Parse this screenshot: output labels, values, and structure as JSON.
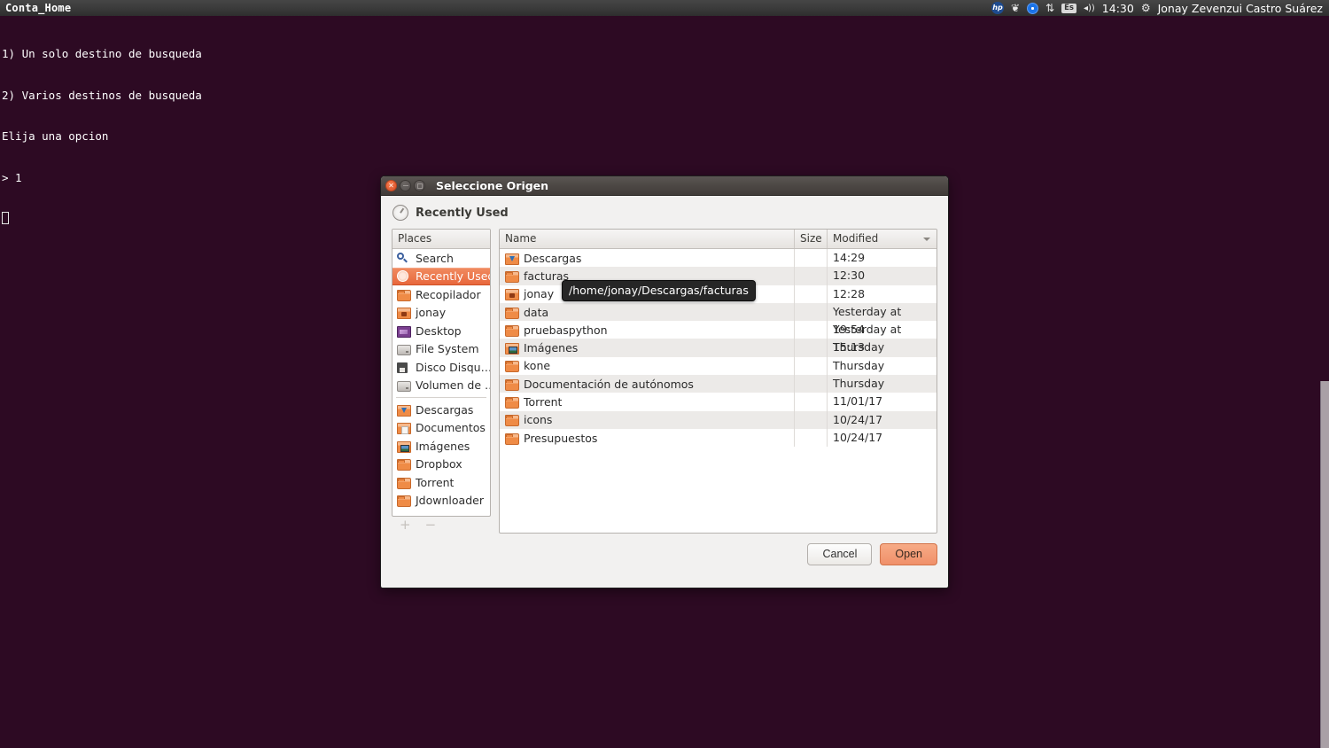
{
  "panel": {
    "app_title": "Conta_Home",
    "tray": [
      {
        "name": "hp-icon",
        "glyph": "hp"
      },
      {
        "name": "dropbox-icon",
        "glyph": "❦"
      },
      {
        "name": "chrome-icon",
        "glyph": ""
      },
      {
        "name": "network-icon",
        "glyph": "⇅"
      },
      {
        "name": "keyboard-layout-indicator",
        "glyph": "Es"
      },
      {
        "name": "volume-icon",
        "glyph": "◂))"
      }
    ],
    "clock": "14:30",
    "gear": "⚙",
    "user": "Jonay Zevenzui Castro Suárez"
  },
  "terminal": {
    "lines": [
      "1) Un solo destino de busqueda",
      "2) Varios destinos de busqueda",
      "Elija una opcion",
      "> 1"
    ]
  },
  "dialog": {
    "title": "Seleccione Origen",
    "location_label": "Recently Used",
    "places": {
      "header": "Places",
      "items": [
        {
          "label": "Search",
          "icon": "search-icon",
          "icon_class": "ic-search",
          "selected": false
        },
        {
          "label": "Recently Used",
          "icon": "recent-clock-icon",
          "icon_class": "ic-clock",
          "selected": true
        },
        {
          "label": "Recopilador",
          "icon": "folder-icon",
          "icon_class": "ic-folder",
          "selected": false
        },
        {
          "label": "jonay",
          "icon": "home-folder-icon",
          "icon_class": "ic-home",
          "selected": false
        },
        {
          "label": "Desktop",
          "icon": "desktop-icon",
          "icon_class": "ic-desktop",
          "selected": false
        },
        {
          "label": "File System",
          "icon": "drive-icon",
          "icon_class": "ic-drive",
          "selected": false
        },
        {
          "label": "Disco Disqu…",
          "icon": "floppy-icon",
          "icon_class": "ic-floppy",
          "selected": false
        },
        {
          "label": "Volumen de …",
          "icon": "drive-icon",
          "icon_class": "ic-drive",
          "selected": false
        },
        {
          "separator": true
        },
        {
          "label": "Descargas",
          "icon": "downloads-folder-icon",
          "icon_class": "ic-dl",
          "selected": false
        },
        {
          "label": "Documentos",
          "icon": "documents-folder-icon",
          "icon_class": "ic-doc",
          "selected": false
        },
        {
          "label": "Imágenes",
          "icon": "pictures-folder-icon",
          "icon_class": "ic-img",
          "selected": false
        },
        {
          "label": "Dropbox",
          "icon": "folder-icon",
          "icon_class": "ic-folder",
          "selected": false
        },
        {
          "label": "Torrent",
          "icon": "folder-icon",
          "icon_class": "ic-folder",
          "selected": false
        },
        {
          "label": "Jdownloader",
          "icon": "folder-icon",
          "icon_class": "ic-folder",
          "selected": false
        }
      ],
      "add_label": "+",
      "remove_label": "−"
    },
    "file_list": {
      "columns": {
        "name": "Name",
        "size": "Size",
        "modified": "Modified"
      },
      "sort": "descending",
      "rows": [
        {
          "name": "Descargas",
          "size": "",
          "modified": "14:29",
          "icon_class": "ic-dl"
        },
        {
          "name": "facturas",
          "size": "",
          "modified": "12:30",
          "icon_class": "ic-folder"
        },
        {
          "name": "jonay",
          "size": "",
          "modified": "12:28",
          "icon_class": "ic-home"
        },
        {
          "name": "data",
          "size": "",
          "modified": "Yesterday at 19:54",
          "icon_class": "ic-folder"
        },
        {
          "name": "pruebaspython",
          "size": "",
          "modified": "Yesterday at 15:13",
          "icon_class": "ic-folder"
        },
        {
          "name": "Imágenes",
          "size": "",
          "modified": "Thursday",
          "icon_class": "ic-img"
        },
        {
          "name": "kone",
          "size": "",
          "modified": "Thursday",
          "icon_class": "ic-folder"
        },
        {
          "name": "Documentación de autónomos",
          "size": "",
          "modified": "Thursday",
          "icon_class": "ic-folder"
        },
        {
          "name": "Torrent",
          "size": "",
          "modified": "11/01/17",
          "icon_class": "ic-folder"
        },
        {
          "name": "icons",
          "size": "",
          "modified": "10/24/17",
          "icon_class": "ic-folder"
        },
        {
          "name": "Presupuestos",
          "size": "",
          "modified": "10/24/17",
          "icon_class": "ic-folder"
        }
      ]
    },
    "tooltip": "/home/jonay/Descargas/facturas",
    "buttons": {
      "cancel": "Cancel",
      "open": "Open"
    }
  },
  "colors": {
    "accent": "#e8673c",
    "terminal_bg": "#2d0a23",
    "panel_bg": "#3b3b3b",
    "dialog_bg": "#f2f1f0"
  }
}
